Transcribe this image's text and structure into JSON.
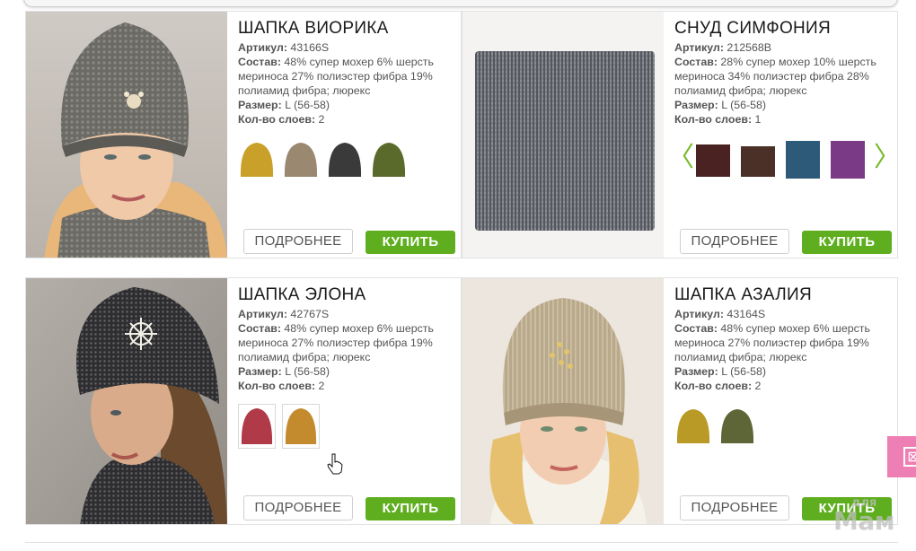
{
  "labels": {
    "sku": "Артикул:",
    "composition": "Состав:",
    "size": "Размер:",
    "layers": "Кол-во слоев:",
    "more_button": "ПОДРОБНЕЕ",
    "buy_button": "КУПИТЬ"
  },
  "products": [
    {
      "title": "ШАПКА ВИОРИКА",
      "sku": "43166S",
      "composition": "48% супер мохер 6% шерсть мериноса 27% полиэстер фибра 19% полиамид фибра; люрекс",
      "size": "L (56-58)",
      "layers": "2",
      "swatches": [
        "#c9a12a",
        "#9a8870",
        "#3a3a3a",
        "#5a6a2a"
      ]
    },
    {
      "title": "СНУД СИМФОНИЯ",
      "sku": "212568B",
      "composition": "28% супер мохер 10% шерсть мериноса 34% полиэстер фибра 28% полиамид фибра; люрекс",
      "size": "L (56-58)",
      "layers": "1",
      "swatches": [
        "#4a2222",
        "#4a3026",
        "#2e5a7a",
        "#7a3a86"
      ],
      "prev_arrow": "〈",
      "next_arrow": "〉"
    },
    {
      "title": "ШАПКА ЭЛОНА",
      "sku": "42767S",
      "composition": "48% супер мохер 6% шерсть мериноса 27% полиэстер фибра 19% полиамид фибра; люрекс",
      "size": "L (56-58)",
      "layers": "2",
      "swatches": [
        "#b03a48",
        "#c48a2e"
      ]
    },
    {
      "title": "ШАПКА АЗАЛИЯ",
      "sku": "43164S",
      "composition": "48% супер мохер 6% шерсть мериноса 27% полиэстер фибра 19% полиамид фибра; люрекс",
      "size": "L (56-58)",
      "layers": "2",
      "swatches": [
        "#b99a26",
        "#5e6638"
      ]
    }
  ],
  "side_tab": {
    "icon": "close-envelope-icon",
    "glyph": "⊠",
    "color": "#ee7fb4"
  },
  "watermark": {
    "line1": "для",
    "line2": "Мам"
  },
  "colors": {
    "buy_green": "#5fae1f",
    "arrow_green": "#76b82a"
  }
}
